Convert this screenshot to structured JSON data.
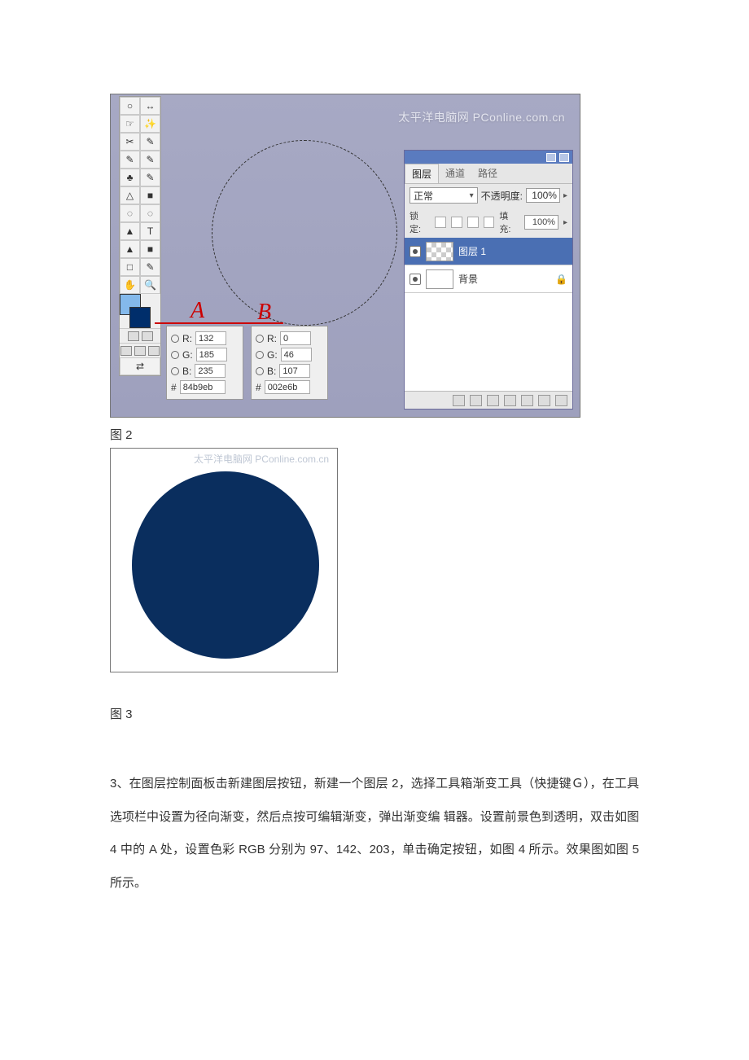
{
  "fig2": {
    "watermark": "太平洋电脑网 PConline.com.cn",
    "colorA": {
      "r": "132",
      "g": "185",
      "b": "235",
      "hex": "84b9eb",
      "label": "A"
    },
    "colorB": {
      "r": "0",
      "g": "46",
      "b": "107",
      "hex": "002e6b",
      "label": "B"
    },
    "layers": {
      "tab1": "图层",
      "tab2": "通道",
      "tab3": "路径",
      "blend": "正常",
      "opacityLabel": "不透明度:",
      "opacityVal": "100%",
      "lockLabel": "锁定:",
      "fillLabel": "填充:",
      "fillVal": "100%",
      "layer1": "图层 1",
      "layerBg": "背景"
    }
  },
  "captions": {
    "fig2": "图 2",
    "fig3": "图 3"
  },
  "fig3": {
    "watermark": "太平洋电脑网 PConline.com.cn"
  },
  "paragraph": "3、在图层控制面板击新建图层按钮，新建一个图层 2，选择工具箱渐变工具（快捷键Ｇ），在工具选项栏中设置为径向渐变，然后点按可编辑渐变，弹出渐变编 辑器。设置前景色到透明，双击如图 4 中的 A 处，设置色彩 RGB 分别为 97、142、203，单击确定按钮，如图 4 所示。效果图如图 5 所示。",
  "rgbLabel": {
    "R": "R:",
    "G": "G:",
    "B": "B:",
    "hash": "#"
  },
  "tools": [
    "○",
    "✛",
    "☞",
    "✎",
    "✂",
    "✎",
    "✎",
    "♣",
    "✎",
    "≡",
    "✎",
    "△",
    "◌",
    "◌",
    "▲",
    "T",
    "▲",
    "■",
    "□",
    "✎",
    "❍",
    "○"
  ]
}
